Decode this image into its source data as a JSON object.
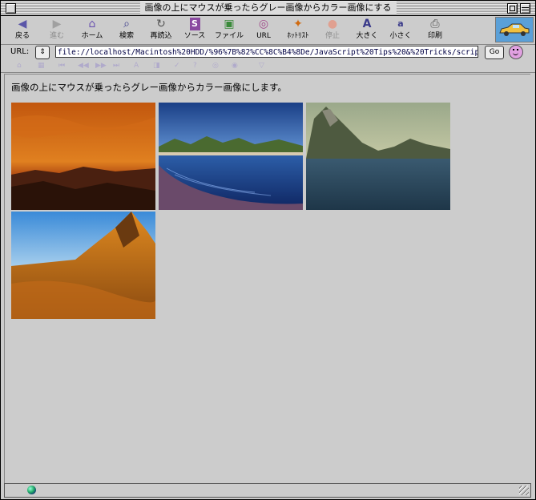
{
  "window": {
    "title": "画像の上にマウスが乗ったらグレー画像からカラー画像にする"
  },
  "toolbar": {
    "buttons": [
      {
        "label": "戻る",
        "icon": "back-arrow-icon",
        "enabled": true
      },
      {
        "label": "進む",
        "icon": "forward-arrow-icon",
        "enabled": false
      },
      {
        "label": "ホーム",
        "icon": "home-icon",
        "enabled": true
      },
      {
        "label": "検索",
        "icon": "search-icon",
        "enabled": true
      },
      {
        "label": "再読込",
        "icon": "reload-icon",
        "enabled": true
      },
      {
        "label": "ソース",
        "icon": "source-icon",
        "enabled": true
      },
      {
        "label": "ファイル",
        "icon": "file-icon",
        "enabled": true
      },
      {
        "label": "URL",
        "icon": "url-globe-icon",
        "enabled": true
      },
      {
        "label": "ﾎｯﾄﾘｽﾄ",
        "icon": "hotlist-icon",
        "enabled": true
      },
      {
        "label": "停止",
        "icon": "stop-icon",
        "enabled": false
      },
      {
        "label": "大きく",
        "icon": "text-larger-icon",
        "enabled": true
      },
      {
        "label": "小さく",
        "icon": "text-smaller-icon",
        "enabled": true
      },
      {
        "label": "印刷",
        "icon": "print-icon",
        "enabled": true
      }
    ]
  },
  "address": {
    "label": "URL:",
    "value": "file://localhost/Macintosh%20HDD/%96%7B%82%CC%8C%B4%8De/JavaScript%20Tips%20&%20Tricks/scrip",
    "go_label": "Go"
  },
  "page": {
    "intro_text": "画像の上にマウスが乗ったらグレー画像からカラー画像にします。",
    "images": [
      {
        "name": "sunset-desert-image"
      },
      {
        "name": "beach-bay-image"
      },
      {
        "name": "mountain-lake-image"
      },
      {
        "name": "orange-mountain-image"
      }
    ]
  },
  "colors": {
    "window_bg": "#cccccc",
    "url_text": "#000044",
    "disabled_text": "#8c8c8c"
  }
}
